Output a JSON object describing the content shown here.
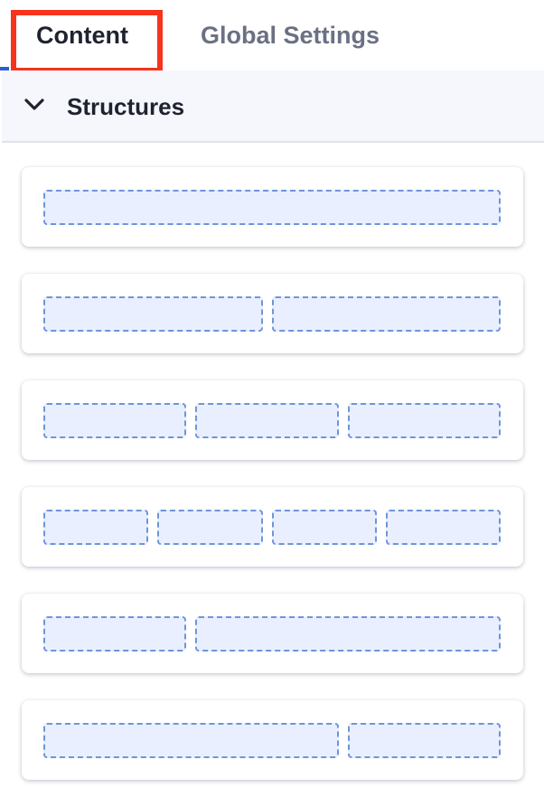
{
  "tabs": {
    "content_label": "Content",
    "global_settings_label": "Global Settings"
  },
  "section": {
    "title": "Structures",
    "expanded": true
  },
  "structures": [
    {
      "columns": [
        1
      ]
    },
    {
      "columns": [
        1,
        1
      ]
    },
    {
      "columns": [
        1,
        1,
        1
      ]
    },
    {
      "columns": [
        1,
        1,
        1,
        1
      ]
    },
    {
      "columns": [
        1,
        2
      ]
    },
    {
      "columns": [
        2,
        1
      ]
    }
  ],
  "colors": {
    "highlight": "#f7331d",
    "active_tab_underline": "#2f5bd3",
    "column_fill": "#e9efff",
    "column_border": "#6e95d9"
  }
}
